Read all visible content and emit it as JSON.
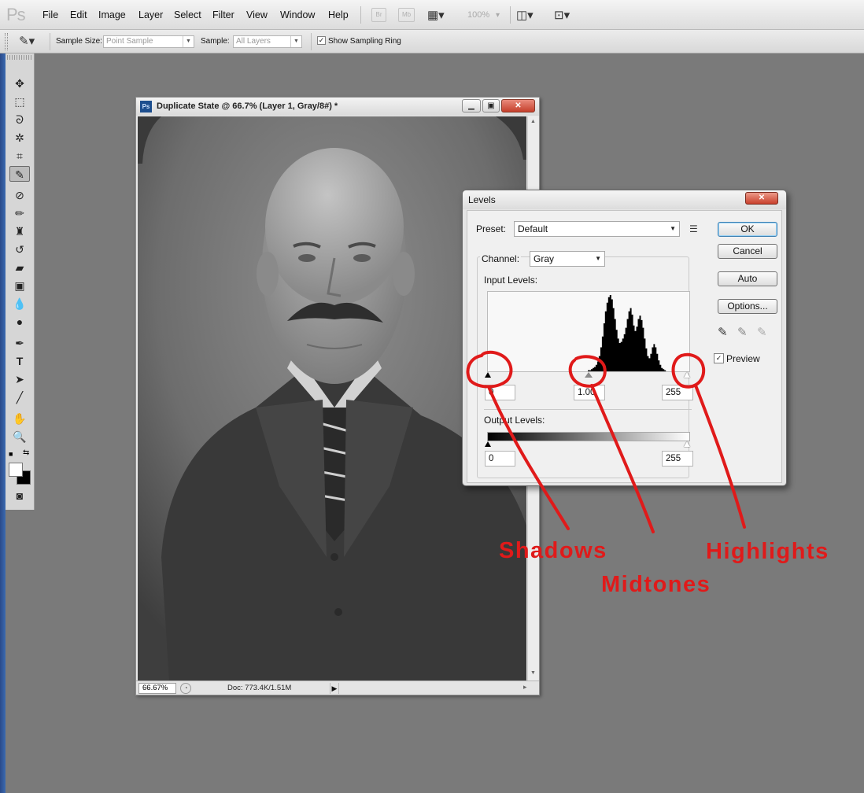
{
  "app": {
    "logo": "Ps"
  },
  "menu": [
    "File",
    "Edit",
    "Image",
    "Layer",
    "Select",
    "Filter",
    "View",
    "Window",
    "Help"
  ],
  "menubar_extras": {
    "bridge": "Br",
    "minibridge": "Mb",
    "zoom": "100%"
  },
  "options_bar": {
    "sample_size_label": "Sample Size:",
    "sample_size_value": "Point Sample",
    "sample_label": "Sample:",
    "sample_value": "All Layers",
    "show_ring_label": "Show Sampling Ring",
    "show_ring_checked": true
  },
  "tools": [
    "move-tool",
    "marquee-tool",
    "lasso-tool",
    "quick-select-tool",
    "crop-tool",
    "eyedropper-tool",
    "healing-brush-tool",
    "brush-tool",
    "clone-stamp-tool",
    "history-brush-tool",
    "eraser-tool",
    "gradient-tool",
    "blur-tool",
    "dodge-tool",
    "pen-tool",
    "type-tool",
    "path-select-tool",
    "line-tool",
    "hand-tool",
    "zoom-tool"
  ],
  "document": {
    "title": "Duplicate State @ 66.7% (Layer 1, Gray/8#) *",
    "zoom": "66.67%",
    "doc_info": "Doc: 773.4K/1.51M"
  },
  "levels_dialog": {
    "title": "Levels",
    "preset_label": "Preset:",
    "preset_value": "Default",
    "channel_label": "Channel:",
    "channel_value": "Gray",
    "input_levels_label": "Input Levels:",
    "input_black": "0",
    "input_gamma": "1.00",
    "input_white": "255",
    "output_levels_label": "Output Levels:",
    "output_black": "0",
    "output_white": "255",
    "buttons": {
      "ok": "OK",
      "cancel": "Cancel",
      "auto": "Auto",
      "options": "Options..."
    },
    "preview_label": "Preview",
    "preview_checked": true,
    "histogram": [
      0,
      0,
      0,
      0,
      0,
      0,
      0,
      0,
      0,
      0,
      0,
      0,
      0,
      0,
      0,
      0,
      0,
      0,
      0,
      0,
      0,
      0,
      0,
      0,
      0,
      0,
      0,
      0,
      0,
      0,
      0,
      0,
      0,
      0,
      0,
      0,
      0,
      0,
      0,
      0,
      0,
      0,
      0,
      0,
      0,
      0,
      0,
      0,
      0,
      0,
      0,
      0,
      0,
      0,
      0,
      0,
      0,
      0,
      0,
      0,
      0,
      0,
      0,
      0,
      1,
      1,
      2,
      3,
      4,
      6,
      9,
      14,
      22,
      32,
      44,
      55,
      63,
      68,
      70,
      66,
      58,
      48,
      38,
      30,
      26,
      27,
      30,
      34,
      40,
      48,
      55,
      58,
      52,
      42,
      37,
      41,
      48,
      51,
      47,
      40,
      30,
      21,
      14,
      12,
      16,
      22,
      25,
      22,
      16,
      10,
      6,
      3,
      2,
      1,
      0,
      0,
      0,
      0,
      0,
      0,
      0,
      0,
      0,
      0,
      0,
      0,
      0,
      0,
      0
    ]
  },
  "annotations": {
    "shadows": "Shadows",
    "midtones": "Midtones",
    "highlights": "Highlights",
    "color": "#e01a1a"
  }
}
